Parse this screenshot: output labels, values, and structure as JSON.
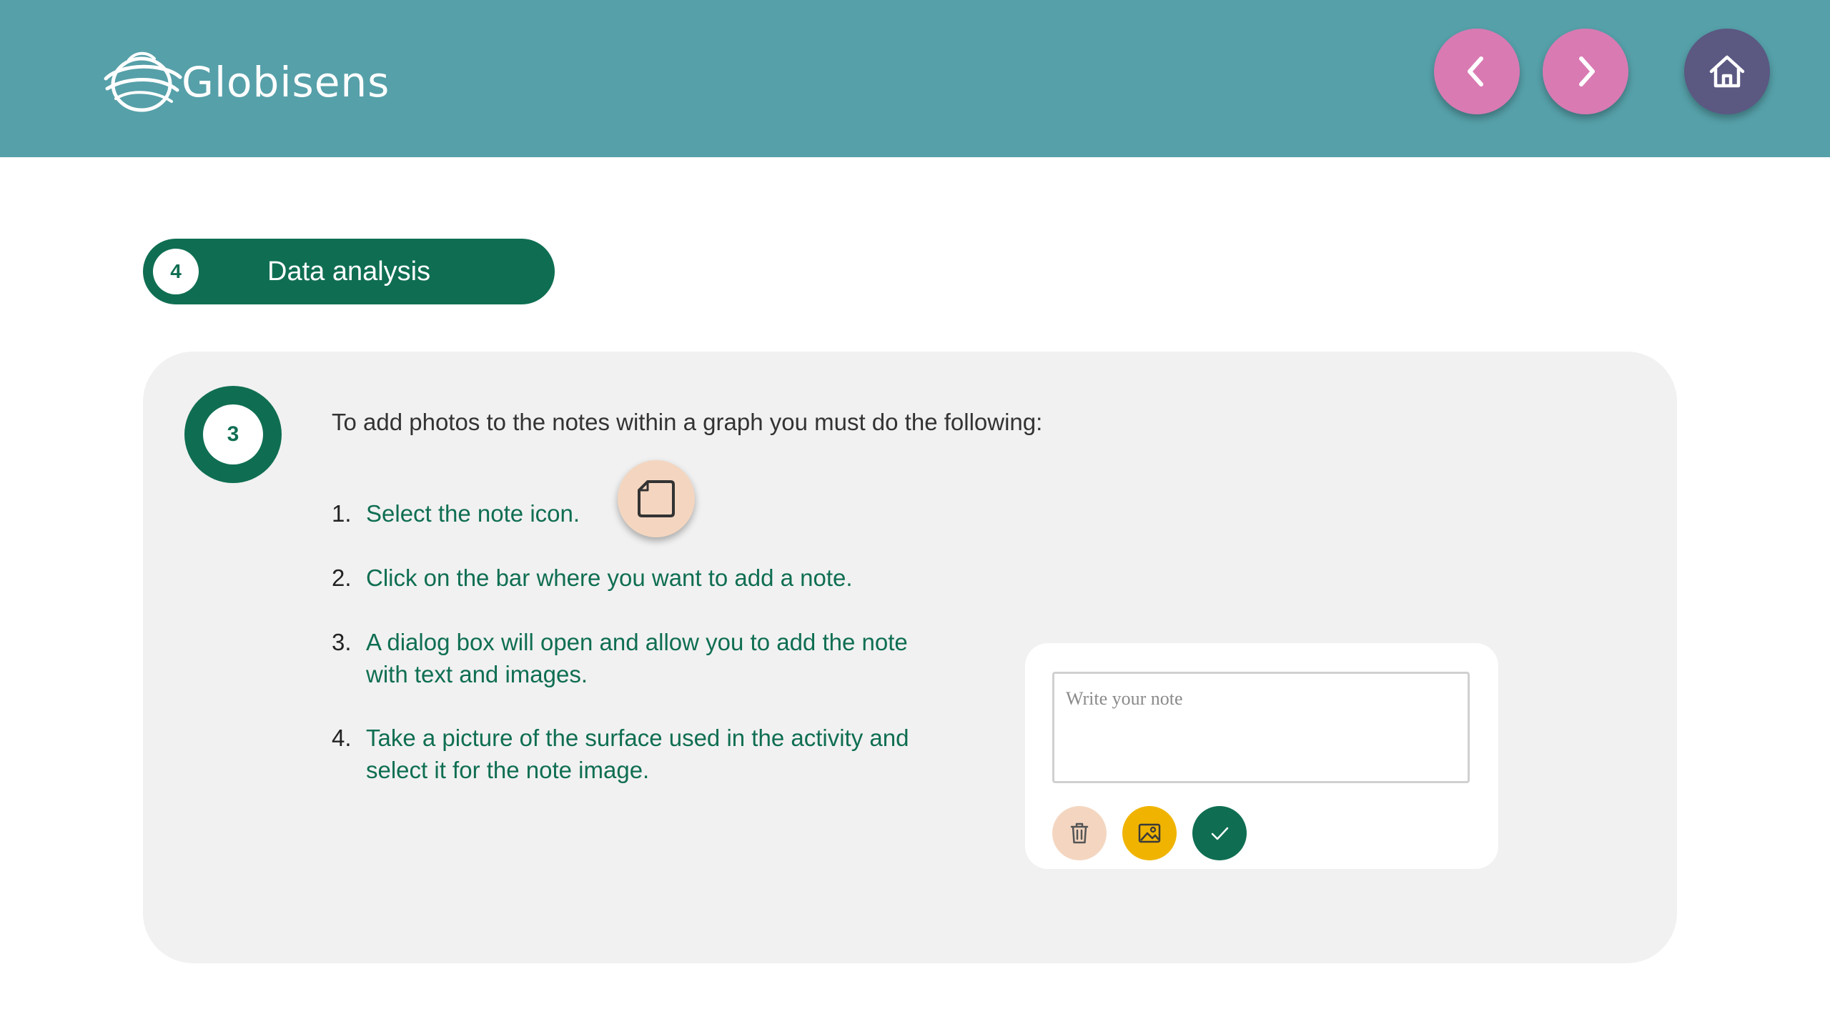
{
  "header": {
    "brand": "Globisens",
    "colors": {
      "background": "#56a0a9",
      "nav": "#d97ab3",
      "home": "#5b5882"
    },
    "buttons": [
      {
        "name": "previous",
        "icon": "chevron-left-icon"
      },
      {
        "name": "next",
        "icon": "chevron-right-icon"
      },
      {
        "name": "home",
        "icon": "home-icon"
      }
    ]
  },
  "section": {
    "number": "4",
    "title": "Data analysis",
    "color": "#0f6e52"
  },
  "card": {
    "step_number": "3",
    "intro": "To add photos to the notes within a graph you must do the following:",
    "steps": [
      {
        "number": "1.",
        "text": "Select the note icon."
      },
      {
        "number": "2.",
        "text": "Click on the bar where you want to add a note."
      },
      {
        "number": "3.",
        "text": "A dialog box will open and allow you to add the note with text and images."
      },
      {
        "number": "4.",
        "text": "Take a picture of the surface used in the activity and select it for the note image."
      }
    ],
    "note_icon": "note-icon"
  },
  "dialog": {
    "placeholder": "Write your note",
    "value": "",
    "buttons": [
      {
        "name": "delete",
        "icon": "trash-icon",
        "color": "#f4d6c0"
      },
      {
        "name": "add-image",
        "icon": "image-icon",
        "color": "#f0b400"
      },
      {
        "name": "confirm",
        "icon": "check-icon",
        "color": "#0f6e52"
      }
    ]
  }
}
